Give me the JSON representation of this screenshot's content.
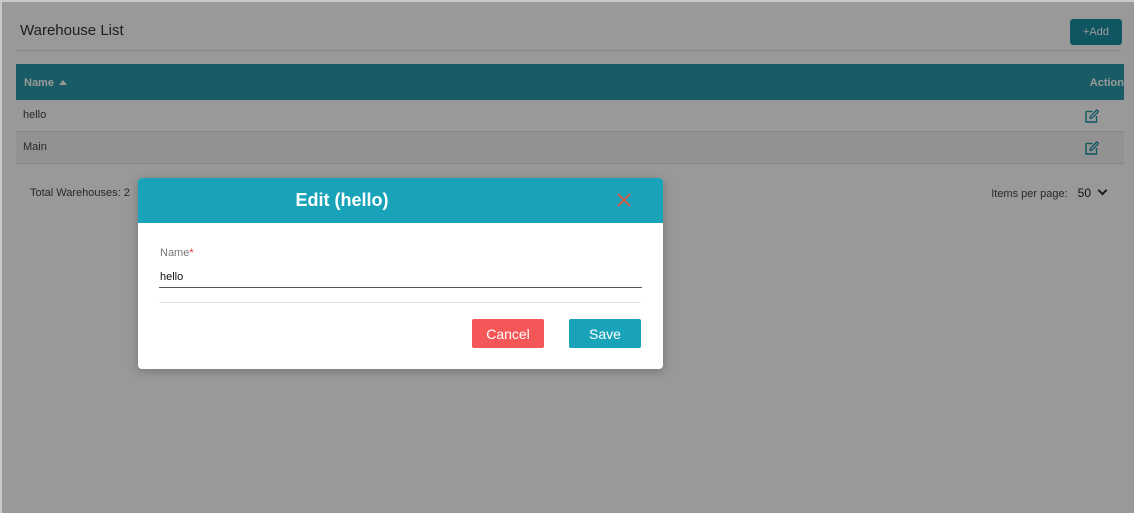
{
  "header": {
    "title": "Warehouse List",
    "add_label": "+Add"
  },
  "table": {
    "columns": {
      "name": "Name",
      "action": "Action"
    },
    "rows": [
      {
        "name": "hello"
      },
      {
        "name": "Main"
      }
    ]
  },
  "footer": {
    "total_text": "Total Warehouses: 2",
    "per_page_label": "Items per page:",
    "per_page_value": "50"
  },
  "modal": {
    "title": "Edit (hello)",
    "field_label": "Name",
    "required_mark": "*",
    "field_value": "hello",
    "cancel_label": "Cancel",
    "save_label": "Save"
  },
  "colors": {
    "accent": "#18a3b9",
    "table_header": "#2a9aa8",
    "cancel": "#f45757",
    "close_icon": "#e0533b"
  },
  "icons": {
    "edit": "edit-icon",
    "close": "close-icon",
    "sort": "sort-up-icon",
    "dropdown": "chevron-down-icon"
  }
}
